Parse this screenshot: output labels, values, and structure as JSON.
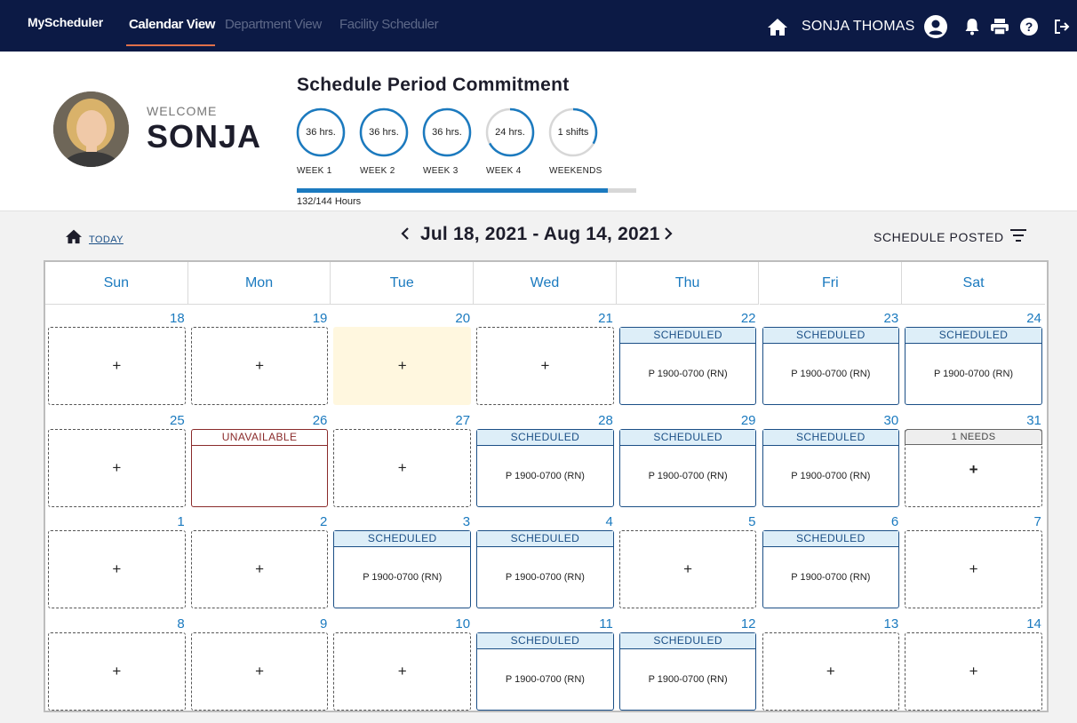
{
  "app": {
    "brand": "MyScheduler"
  },
  "nav": {
    "tabs": [
      "Calendar View",
      "Department View",
      "Facility Scheduler"
    ],
    "user_name": "SONJA THOMAS"
  },
  "welcome": {
    "label": "WELCOME",
    "name": "SONJA"
  },
  "commitment": {
    "title": "Schedule Period Commitment",
    "rings": [
      {
        "value": "36 hrs.",
        "label": "WEEK 1",
        "fill": 1.0
      },
      {
        "value": "36 hrs.",
        "label": "WEEK 2",
        "fill": 1.0
      },
      {
        "value": "36 hrs.",
        "label": "WEEK 3",
        "fill": 1.0
      },
      {
        "value": "24 hrs.",
        "label": "WEEK 4",
        "fill": 0.67
      },
      {
        "value": "1 shifts",
        "label": "WEEKENDS",
        "fill": 0.33
      }
    ],
    "progress_text": "132/144 Hours",
    "progress_fraction": 0.917
  },
  "toolbar": {
    "today_label": "TODAY",
    "range": "Jul 18, 2021 - Aug 14, 2021",
    "status": "SCHEDULE POSTED"
  },
  "calendar": {
    "days_of_week": [
      "Sun",
      "Mon",
      "Tue",
      "Wed",
      "Thu",
      "Fri",
      "Sat"
    ],
    "weeks": [
      [
        {
          "day": "18",
          "type": "empty",
          "text": "+"
        },
        {
          "day": "19",
          "type": "empty",
          "text": "+"
        },
        {
          "day": "20",
          "type": "today",
          "text": "+"
        },
        {
          "day": "21",
          "type": "empty",
          "text": "+"
        },
        {
          "day": "22",
          "type": "sched",
          "header": "SCHEDULED",
          "text": "P 1900-0700 (RN)"
        },
        {
          "day": "23",
          "type": "sched",
          "header": "SCHEDULED",
          "text": "P 1900-0700 (RN)"
        },
        {
          "day": "24",
          "type": "sched",
          "header": "SCHEDULED",
          "text": "P 1900-0700 (RN)"
        }
      ],
      [
        {
          "day": "25",
          "type": "empty",
          "text": "+"
        },
        {
          "day": "26",
          "type": "unavail",
          "header": "UNAVAILABLE"
        },
        {
          "day": "27",
          "type": "empty",
          "text": "+"
        },
        {
          "day": "28",
          "type": "sched",
          "header": "SCHEDULED",
          "text": "P 1900-0700 (RN)"
        },
        {
          "day": "29",
          "type": "sched",
          "header": "SCHEDULED",
          "text": "P 1900-0700 (RN)"
        },
        {
          "day": "30",
          "type": "sched",
          "header": "SCHEDULED",
          "text": "P 1900-0700 (RN)"
        },
        {
          "day": "31",
          "type": "needs",
          "header": "1 NEEDS",
          "text": "+"
        }
      ],
      [
        {
          "day": "1",
          "type": "empty",
          "text": "+"
        },
        {
          "day": "2",
          "type": "empty",
          "text": "+"
        },
        {
          "day": "3",
          "type": "sched",
          "header": "SCHEDULED",
          "text": "P 1900-0700 (RN)"
        },
        {
          "day": "4",
          "type": "sched",
          "header": "SCHEDULED",
          "text": "P 1900-0700 (RN)"
        },
        {
          "day": "5",
          "type": "empty",
          "text": "+"
        },
        {
          "day": "6",
          "type": "sched",
          "header": "SCHEDULED",
          "text": "P 1900-0700 (RN)"
        },
        {
          "day": "7",
          "type": "empty",
          "text": "+"
        }
      ],
      [
        {
          "day": "8",
          "type": "empty",
          "text": "+"
        },
        {
          "day": "9",
          "type": "empty",
          "text": "+"
        },
        {
          "day": "10",
          "type": "empty",
          "text": "+"
        },
        {
          "day": "11",
          "type": "sched",
          "header": "SCHEDULED",
          "text": "P 1900-0700 (RN)"
        },
        {
          "day": "12",
          "type": "sched",
          "header": "SCHEDULED",
          "text": "P 1900-0700 (RN)"
        },
        {
          "day": "13",
          "type": "empty",
          "text": "+"
        },
        {
          "day": "14",
          "type": "empty",
          "text": "+"
        }
      ]
    ]
  },
  "icons": {
    "home": "home-icon",
    "user": "account-circle-icon",
    "bell": "bell-icon",
    "print": "printer-icon",
    "help": "help-icon",
    "logout": "logout-icon",
    "filter": "filter-icon"
  },
  "colors": {
    "nav_bg": "#0c1a45",
    "accent": "#1b7abf",
    "scheduled": "#1b4f86",
    "unavailable": "#8a2b2b",
    "today": "#fff7df"
  }
}
